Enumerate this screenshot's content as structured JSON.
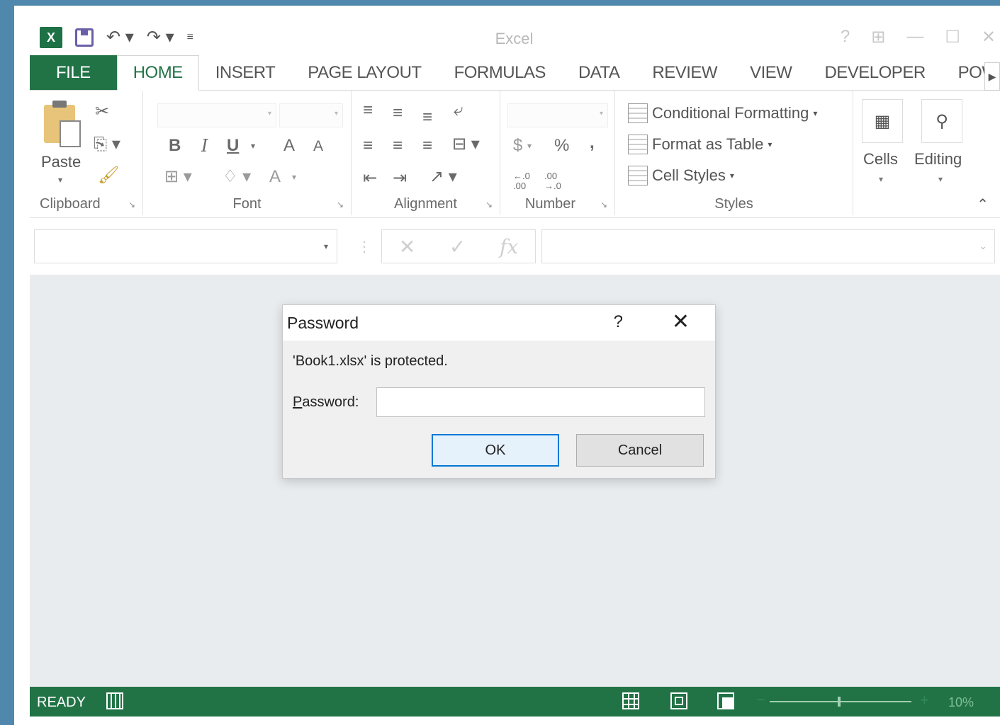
{
  "app": {
    "title": "Excel"
  },
  "quick_access": {
    "logo_text": "X",
    "icons": [
      "excel-logo-icon",
      "save-icon",
      "undo-icon",
      "redo-icon",
      "customize-qat-icon"
    ]
  },
  "window_controls": {
    "help": "?",
    "minimize": "—",
    "restore": "☐",
    "close": "✕"
  },
  "tabs": [
    {
      "label": "FILE"
    },
    {
      "label": "HOME"
    },
    {
      "label": "INSERT"
    },
    {
      "label": "PAGE LAYOUT"
    },
    {
      "label": "FORMULAS"
    },
    {
      "label": "DATA"
    },
    {
      "label": "REVIEW"
    },
    {
      "label": "VIEW"
    },
    {
      "label": "DEVELOPER"
    },
    {
      "label": "POWER"
    }
  ],
  "ribbon": {
    "clipboard": {
      "label": "Clipboard",
      "paste_label": "Paste"
    },
    "font": {
      "label": "Font",
      "bold": "B",
      "italic": "I",
      "underline": "U",
      "grow": "A",
      "shrink": "A",
      "font_color": "A"
    },
    "alignment": {
      "label": "Alignment"
    },
    "number": {
      "label": "Number",
      "currency": "$",
      "percent": "%",
      "comma": ",",
      "increase_decimal": "←.0 .00",
      "decrease_decimal": ".00 →.0"
    },
    "styles": {
      "label": "Styles",
      "conditional_formatting": "Conditional Formatting",
      "format_as_table": "Format as Table",
      "cell_styles": "Cell Styles"
    },
    "cells": {
      "label": "Cells"
    },
    "editing": {
      "label": "Editing"
    }
  },
  "formula_bar": {
    "name_box_value": "",
    "formula_value": "",
    "cancel": "✕",
    "enter": "✓",
    "fx": "fx"
  },
  "dialog": {
    "title": "Password",
    "help": "?",
    "close": "✕",
    "message": "'Book1.xlsx' is protected.",
    "password_label_first": "P",
    "password_label_rest": "assword:",
    "password_value": "",
    "ok_label": "OK",
    "cancel_label": "Cancel"
  },
  "status": {
    "text": "READY",
    "zoom_minus": "−",
    "zoom_plus": "+",
    "zoom_level": "10%"
  },
  "colors": {
    "accent": "#217346",
    "desktop": "#4f87ad",
    "dialog_ok_border": "#0078d7"
  }
}
